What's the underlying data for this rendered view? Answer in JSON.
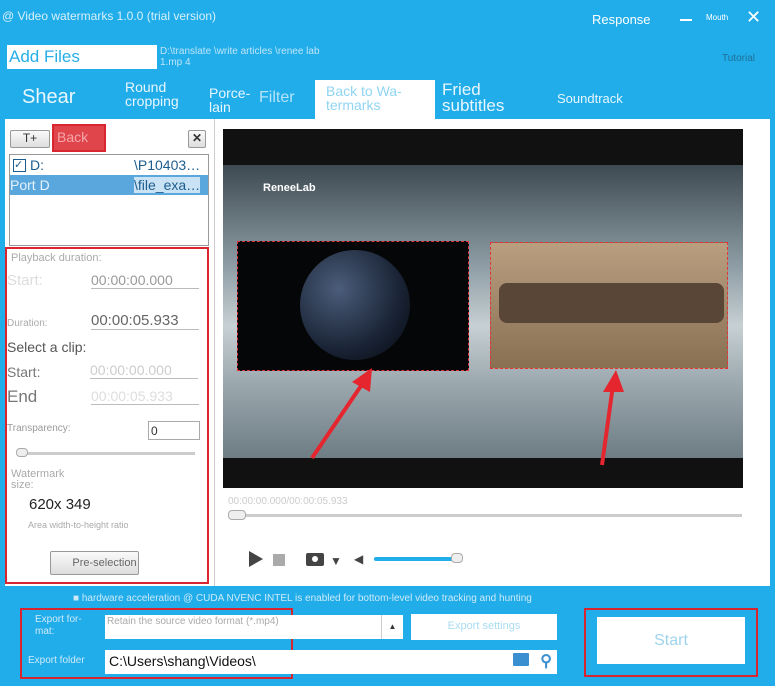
{
  "window": {
    "title": "@ Video watermarks 1.0.0 (trial version)",
    "response": "Response",
    "mouth": "Mouth",
    "close": "✕"
  },
  "toolbar": {
    "add_files": "Add Files",
    "file_path": "D:\\translate \\write articles \\renee lab 1.mp 4",
    "tutorial": "Tutorial"
  },
  "tabs": [
    {
      "label": "Shear"
    },
    {
      "label": "Round cropping"
    },
    {
      "label": "Porce-lain"
    },
    {
      "label": "Filter"
    },
    {
      "label": "Back to Wa-termarks",
      "active": true
    },
    {
      "label": "Fried subtitles"
    },
    {
      "label": "Soundtrack"
    }
  ],
  "left": {
    "add_text": "T+",
    "back": "Back",
    "delete": "✕",
    "files": [
      {
        "name": "D:",
        "suffix": "\\P10403…",
        "checked": true
      },
      {
        "name": "Port D",
        "suffix": "\\file_exa…",
        "selected": true
      }
    ],
    "playback_duration": "Playback duration:",
    "start_label": "Start:",
    "start_value": "00:00:00.000",
    "duration_label": "Duration:",
    "duration_value": "00:00:05.933",
    "select_clip": "Select a clip:",
    "clip_start_label": "Start:",
    "clip_start": "00:00:00.000",
    "clip_end_label": "End",
    "clip_end": "00:00:05.933",
    "transparency_label": "Transparency:",
    "transparency_value": "0",
    "transparency_slider": 0,
    "watermark_size_label": "Watermark size:",
    "watermark_size": "620x 349",
    "ratio_label": "Area width-to-height ratio",
    "preselection": "Pre-selection"
  },
  "preview": {
    "logo": "ReneeLab",
    "time": "00:00:00.000/00:00:05.933",
    "progress": 0,
    "volume": 0.95
  },
  "bottom": {
    "hw_note": "■ hardware acceleration @ CUDA NVENC INTEL is enabled for bottom-level video tracking and hunting",
    "export_format_label": "Export for-mat:",
    "export_format": "Retain the source video format (*.mp4)",
    "export_settings": "Export settings",
    "export_folder_label": "Export folder",
    "export_folder": "C:\\Users\\shang\\Videos\\",
    "start": "Start"
  },
  "colors": {
    "accent": "#21adea",
    "highlight": "#d9252f"
  }
}
